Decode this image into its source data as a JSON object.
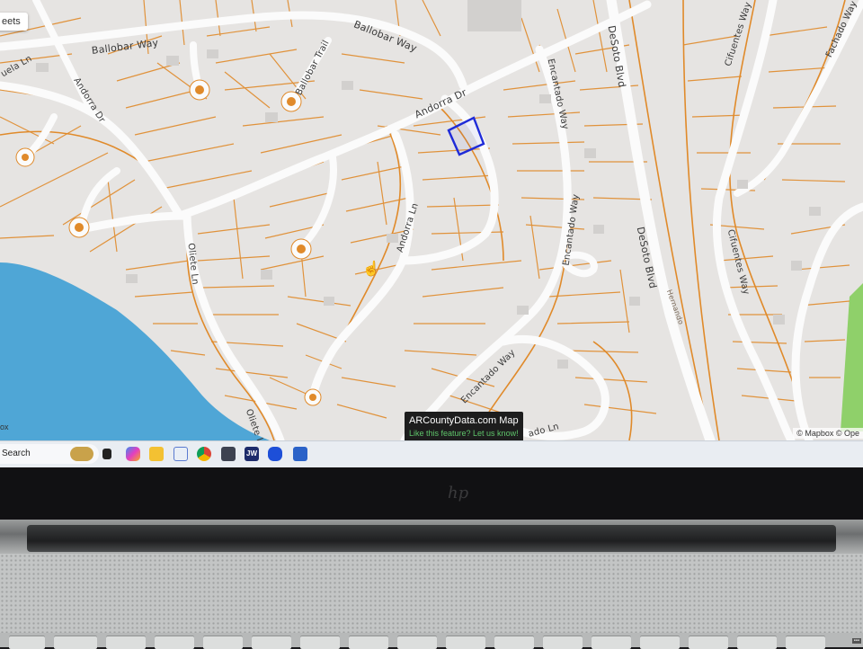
{
  "map": {
    "layer_button": "eets",
    "street_labels": {
      "ballobar_way_1": "Ballobar Way",
      "ballobar_way_2": "Ballobar Way",
      "ballobar_trail": "Ballobar Trail",
      "andorra_dr_1": "Andorra Dr",
      "andorra_dr_2": "Andorra Dr",
      "andorra_ln": "Andorra Ln",
      "oliete_ln_1": "Oliete Ln",
      "oliete_ln_2": "Oliete Ln",
      "encantado_way_1": "Encantado Way",
      "encantado_way_2": "Encantado Way",
      "encantado_way_3": "Encantado Way",
      "encantado_ln": "ado Ln",
      "desoto_blvd_1": "DeSoto Blvd",
      "desoto_blvd_2": "DeSoto Blvd",
      "cifuentes_way_1": "Cifuentes Way",
      "cifuentes_way_2": "Cifuentes Way",
      "fachado_way": "Fachado Way",
      "hernando": "Hernando",
      "ruela_ln": "uela Ln"
    },
    "tooltip": {
      "title": "ARCountyData.com Map",
      "link": "Like this feature? Let us know!"
    },
    "attribution": "© Mapbox © Ope",
    "logo_fragment": "ox",
    "selected_parcel_color": "#1f2bd8",
    "parcel_line_color": "#e08a2a",
    "water_color": "#4fa6d6",
    "park_color": "#8fd06a"
  },
  "taskbar": {
    "search_label": "Search",
    "pinned_icons": [
      "weather-icon",
      "desktop-icon",
      "copilot-icon",
      "file-explorer-icon",
      "snipping-tool-icon",
      "chrome-icon",
      "photos-icon",
      "jw-icon",
      "malwarebytes-icon",
      "app-icon"
    ],
    "jw_label": "JW"
  },
  "device": {
    "brand_logo": "hp"
  }
}
